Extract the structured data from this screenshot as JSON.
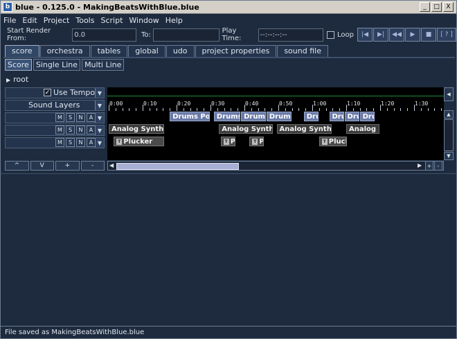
{
  "window": {
    "title": "blue - 0.125.0 - MakingBeatsWithBlue.blue",
    "app_icon": "b",
    "controls": [
      "_",
      "□",
      "X"
    ]
  },
  "menu": [
    "File",
    "Edit",
    "Project",
    "Tools",
    "Script",
    "Window",
    "Help"
  ],
  "toolbar": {
    "start_render_label": "Start Render From:",
    "start_render_value": "0.0",
    "to_label": "To:",
    "to_value": "",
    "play_time_label": "Play Time:",
    "play_time_value": "--:--:--:--",
    "loop_label": "Loop",
    "loop_checked": false,
    "help_button": "[ ? ]"
  },
  "tabs": [
    "score",
    "orchestra",
    "tables",
    "global",
    "udo",
    "project properties",
    "sound file"
  ],
  "active_tab": "score",
  "subtabs": [
    "Score",
    "Single Line",
    "Multi Line"
  ],
  "active_subtab": "Score",
  "breadcrumb": "root",
  "left_panel": {
    "use_tempo_label": "Use Tempo",
    "use_tempo_checked": true,
    "sound_layers_label": "Sound Layers",
    "layer_buttons": [
      "M",
      "S",
      "N",
      "A"
    ],
    "bottom_buttons": [
      "^",
      "V",
      "+",
      "-"
    ]
  },
  "ruler": {
    "labels": [
      "0:00",
      "0:10",
      "0:20",
      "0:30",
      "0:40",
      "0:50",
      "1:00",
      "1:10",
      "1:20",
      "1:30"
    ]
  },
  "layers": [
    {
      "blocks": [
        {
          "label": "Drums Poly",
          "start": 18,
          "len": 12
        },
        {
          "label": "Drums Po",
          "start": 31,
          "len": 8
        },
        {
          "label": "Drums Po",
          "start": 39,
          "len": 7.5
        },
        {
          "label": "Drums Po",
          "start": 46.5,
          "len": 7.5
        },
        {
          "label": "Drum",
          "start": 57.5,
          "len": 4.5
        },
        {
          "label": "Drum",
          "start": 65,
          "len": 4.5
        },
        {
          "label": "Drum",
          "start": 69.5,
          "len": 4.5
        },
        {
          "label": "Drum",
          "start": 74,
          "len": 4.5
        }
      ]
    },
    {
      "blocks": [
        {
          "label": "Analog Synth",
          "start": 0,
          "len": 16.5
        },
        {
          "label": "Analog Synth",
          "start": 32.5,
          "len": 16
        },
        {
          "label": "Analog Synth",
          "start": 49.5,
          "len": 16.5
        },
        {
          "label": "Analog Synth",
          "start": 70,
          "len": 10
        }
      ]
    },
    {
      "blocks": [
        {
          "label": "Plucker",
          "start": 1.5,
          "len": 15,
          "badge": "T"
        },
        {
          "label": "Plu",
          "start": 33,
          "len": 4.5,
          "badge": "T"
        },
        {
          "label": "Plu",
          "start": 41.5,
          "len": 4.5,
          "badge": "T"
        },
        {
          "label": "Plucker",
          "start": 62,
          "len": 8.5,
          "badge": "T"
        }
      ]
    }
  ],
  "scroll": {
    "zoom_in": "+",
    "zoom_out": "-"
  },
  "status": "File saved as MakingBeatsWithBlue.blue"
}
